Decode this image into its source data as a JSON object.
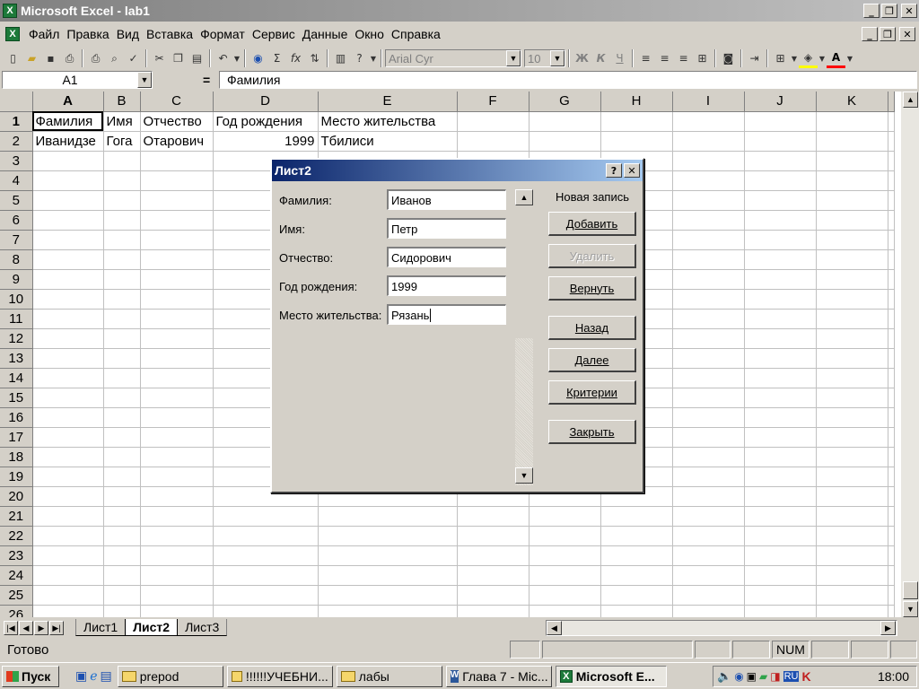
{
  "window": {
    "title": "Microsoft Excel - lab1"
  },
  "menu": [
    "Файл",
    "Правка",
    "Вид",
    "Вставка",
    "Формат",
    "Сервис",
    "Данные",
    "Окно",
    "Справка"
  ],
  "toolbar": {
    "font_name": "Arial Cyr",
    "font_size": "10",
    "bold": "Ж",
    "italic": "К",
    "underline": "Ч"
  },
  "formula_bar": {
    "name_box": "A1",
    "eq": "=",
    "content": "Фамилия"
  },
  "grid": {
    "columns": [
      "A",
      "B",
      "C",
      "D",
      "E",
      "F",
      "G",
      "H",
      "I",
      "J",
      "K"
    ],
    "rows": [
      "1",
      "2",
      "3",
      "4",
      "5",
      "6",
      "7",
      "8",
      "9",
      "10",
      "11",
      "12",
      "13",
      "14",
      "15",
      "16",
      "17",
      "18",
      "19",
      "20",
      "21",
      "22",
      "23",
      "24",
      "25",
      "26"
    ],
    "row1": [
      "Фамилия",
      "Имя",
      "Отчество",
      "Год рождения",
      "Место жительства"
    ],
    "row2": [
      "Иванидзе",
      "Гога",
      "Отарович",
      "1999",
      "Тбилиси"
    ]
  },
  "dialog": {
    "title": "Лист2",
    "record_label": "Новая запись",
    "fields": [
      {
        "label": "Фамилия:",
        "value": "Иванов"
      },
      {
        "label": "Имя:",
        "value": "Петр"
      },
      {
        "label": "Отчество:",
        "value": "Сидорович"
      },
      {
        "label": "Год рождения:",
        "value": "1999"
      },
      {
        "label": "Место жительства:",
        "value": "Рязань"
      }
    ],
    "buttons": {
      "add": "Добавить",
      "delete": "Удалить",
      "restore": "Вернуть",
      "prev": "Назад",
      "next": "Далее",
      "criteria": "Критерии",
      "close": "Закрыть"
    }
  },
  "sheets": [
    "Лист1",
    "Лист2",
    "Лист3"
  ],
  "status": {
    "text": "Готово",
    "num": "NUM"
  },
  "taskbar": {
    "start": "Пуск",
    "items": [
      "prepod",
      "!!!!!!УЧЕБНИ...",
      "лабы",
      "Глава 7 - Mic...",
      "Microsoft E..."
    ],
    "lang": "RU",
    "clock": "18:00"
  },
  "colors": {
    "dialog_caption": "#0a246a",
    "face": "#d4d0c8",
    "excel_green": "#1d7a3a"
  }
}
